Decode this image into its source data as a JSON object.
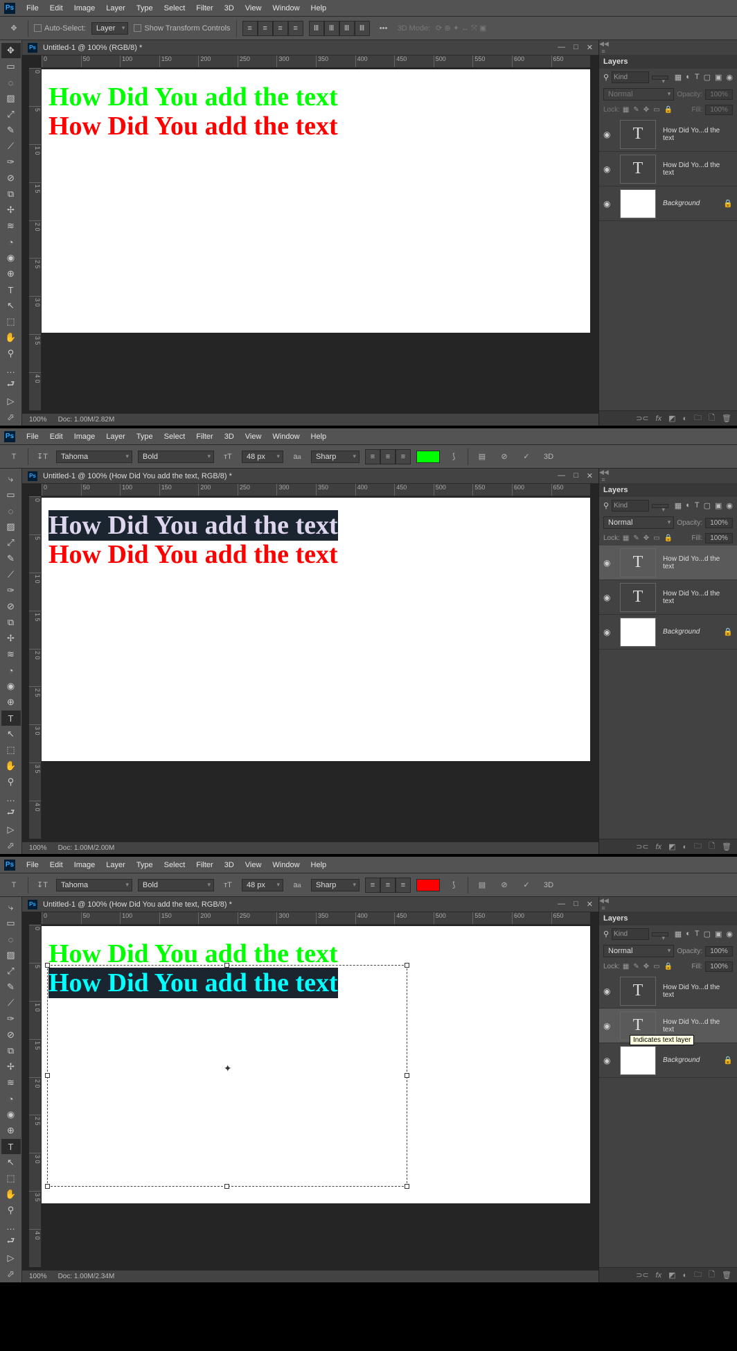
{
  "app": {
    "icon": "Ps"
  },
  "menus": [
    "File",
    "Edit",
    "Image",
    "Layer",
    "Type",
    "Select",
    "Filter",
    "3D",
    "View",
    "Window",
    "Help"
  ],
  "ruler_h": [
    "0",
    "50",
    "100",
    "150",
    "200",
    "250",
    "300",
    "350",
    "400",
    "450",
    "500",
    "550",
    "600",
    "650"
  ],
  "ruler_v": [
    "0",
    "5",
    "1 0",
    "1 5",
    "2 0",
    "2 5",
    "3 0",
    "3 5",
    "4 0"
  ],
  "shot1": {
    "tab_title": "Untitled-1 @ 100% (RGB/8) *",
    "opt_auto": "Auto-Select:",
    "opt_layer": "Layer",
    "opt_transform": "Show Transform Controls",
    "opt_3d": "3D Mode:",
    "text1": "How Did You add the text",
    "text2": "How Did You add the text",
    "status_zoom": "100%",
    "status_doc": "Doc: 1.00M/2.82M",
    "panel_title": "Layers",
    "filter_kind": "Kind",
    "blend": "Normal",
    "opacity_lbl": "Opacity:",
    "opacity_val": "100%",
    "lock_lbl": "Lock:",
    "fill_lbl": "Fill:",
    "fill_val": "100%",
    "layers": [
      {
        "name": "How Did Yo...d the text",
        "type": "T"
      },
      {
        "name": "How Did Yo...d the text",
        "type": "T"
      },
      {
        "name": "Background",
        "type": "bg",
        "locked": true
      }
    ]
  },
  "shot2": {
    "tab_title": "Untitled-1 @ 100% (How Did You add the text, RGB/8) *",
    "font": "Tahoma",
    "weight": "Bold",
    "size": "48 px",
    "aa": "Sharp",
    "swatch": "#00ff00",
    "text1": "How Did You add the text",
    "text2": "How Did You add the text",
    "status_zoom": "100%",
    "status_doc": "Doc: 1.00M/2.00M",
    "panel_title": "Layers",
    "filter_kind": "Kind",
    "blend": "Normal",
    "opacity_lbl": "Opacity:",
    "opacity_val": "100%",
    "lock_lbl": "Lock:",
    "fill_lbl": "Fill:",
    "fill_val": "100%",
    "layers": [
      {
        "name": "How Did Yo...d the text",
        "type": "T",
        "selected": true
      },
      {
        "name": "How Did Yo...d the text",
        "type": "T"
      },
      {
        "name": "Background",
        "type": "bg",
        "locked": true
      }
    ]
  },
  "shot3": {
    "tab_title": "Untitled-1 @ 100% (How Did You add the text, RGB/8) *",
    "font": "Tahoma",
    "weight": "Bold",
    "size": "48 px",
    "aa": "Sharp",
    "swatch": "#ff0000",
    "text1": "How Did You add the text",
    "text2": "How Did You add the text",
    "status_zoom": "100%",
    "status_doc": "Doc: 1.00M/2.34M",
    "panel_title": "Layers",
    "filter_kind": "Kind",
    "blend": "Normal",
    "opacity_lbl": "Opacity:",
    "opacity_val": "100%",
    "lock_lbl": "Lock:",
    "fill_lbl": "Fill:",
    "fill_val": "100%",
    "tooltip": "Indicates text layer",
    "layers": [
      {
        "name": "How Did Yo...d the text",
        "type": "T"
      },
      {
        "name": "How Did Yo...d the text",
        "type": "T",
        "selected": true
      },
      {
        "name": "Background",
        "type": "bg",
        "locked": true
      }
    ]
  },
  "tools_move": [
    "✥",
    "▭",
    "◌",
    "▨",
    "⤢",
    "✎",
    "⟋",
    "✑",
    "⊘",
    "⧉",
    "✢",
    "≋",
    "◔",
    "◉",
    "⊕",
    "T",
    "↖",
    "⬚",
    "✋",
    "⚲",
    "…",
    "⮐",
    "▷",
    "⬀"
  ],
  "tools_type": [
    "⤷",
    "▭",
    "◌",
    "▨",
    "⤢",
    "✎",
    "⟋",
    "✑",
    "⊘",
    "⧉",
    "✢",
    "≋",
    "◔",
    "◉",
    "⊕",
    "T",
    "↖",
    "⬚",
    "✋",
    "⚲",
    "…",
    "⮐",
    "▷",
    "⬀"
  ]
}
